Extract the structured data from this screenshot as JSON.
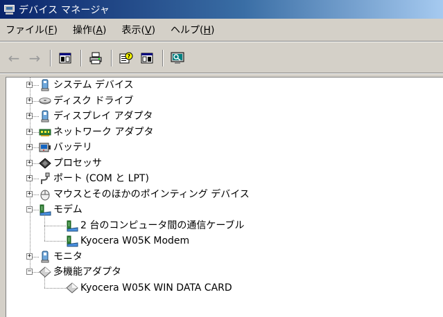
{
  "window": {
    "title": "デバイス マネージャ"
  },
  "menu": [
    {
      "label": "ファイル(",
      "acc": "F",
      "tail": ")"
    },
    {
      "label": "操作(",
      "acc": "A",
      "tail": ")"
    },
    {
      "label": "表示(",
      "acc": "V",
      "tail": ")"
    },
    {
      "label": "ヘルプ(",
      "acc": "H",
      "tail": ")"
    }
  ],
  "toolbar": {
    "back_icon": "←",
    "forward_icon": "→"
  },
  "tree": [
    {
      "label": "システム デバイス",
      "state": "collapsed",
      "icon": "system-devices-icon"
    },
    {
      "label": "ディスク ドライブ",
      "state": "collapsed",
      "icon": "disk-drive-icon"
    },
    {
      "label": "ディスプレイ アダプタ",
      "state": "collapsed",
      "icon": "display-adapter-icon"
    },
    {
      "label": "ネットワーク アダプタ",
      "state": "collapsed",
      "icon": "network-adapter-icon"
    },
    {
      "label": "バッテリ",
      "state": "collapsed",
      "icon": "battery-icon"
    },
    {
      "label": "プロセッサ",
      "state": "collapsed",
      "icon": "processor-icon"
    },
    {
      "label": "ポート (COM と LPT)",
      "state": "collapsed",
      "icon": "port-icon"
    },
    {
      "label": "マウスとそのほかのポインティング デバイス",
      "state": "collapsed",
      "icon": "mouse-icon"
    },
    {
      "label": "モデム",
      "state": "expanded",
      "icon": "modem-icon",
      "children": [
        {
          "label": "2 台のコンピュータ間の通信ケーブル",
          "icon": "modem-icon"
        },
        {
          "label": "Kyocera W05K Modem",
          "icon": "modem-icon"
        }
      ]
    },
    {
      "label": "モニタ",
      "state": "collapsed",
      "icon": "monitor-icon"
    },
    {
      "label": "多機能アダプタ",
      "state": "expanded",
      "icon": "multifunction-adapter-icon",
      "children": [
        {
          "label": "Kyocera W05K WIN DATA CARD",
          "icon": "multifunction-adapter-icon"
        }
      ]
    }
  ],
  "expander_symbols": {
    "collapsed": "+",
    "expanded": "−"
  }
}
